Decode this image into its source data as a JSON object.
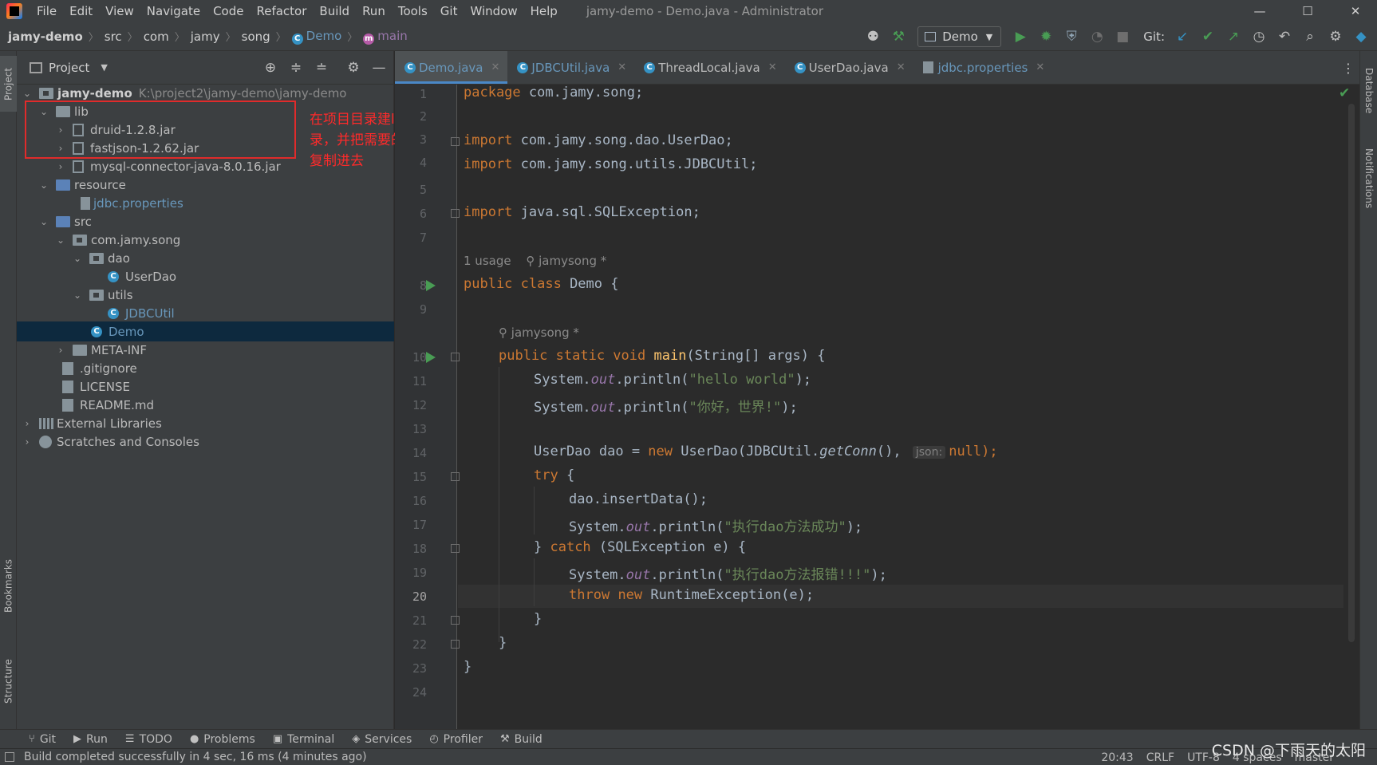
{
  "window": {
    "title": "jamy-demo - Demo.java - Administrator",
    "menu": [
      "File",
      "Edit",
      "View",
      "Navigate",
      "Code",
      "Refactor",
      "Build",
      "Run",
      "Tools",
      "Git",
      "Window",
      "Help"
    ],
    "minimize": "—",
    "maximize": "☐",
    "close": "✕"
  },
  "breadcrumb": {
    "project": "jamy-demo",
    "parts": [
      "src",
      "com",
      "jamy",
      "song"
    ],
    "class_name": "Demo",
    "method_name": "main"
  },
  "toolbar": {
    "run_config": "Demo",
    "git_label": "Git:"
  },
  "project_panel": {
    "title": "Project",
    "root_name": "jamy-demo",
    "root_path": "K:\\project2\\jamy-demo\\jamy-demo",
    "items": [
      {
        "label": "lib"
      },
      {
        "label": "druid-1.2.8.jar"
      },
      {
        "label": "fastjson-1.2.62.jar"
      },
      {
        "label": "mysql-connector-java-8.0.16.jar"
      },
      {
        "label": "resource"
      },
      {
        "label": "jdbc.properties"
      },
      {
        "label": "src"
      },
      {
        "label": "com.jamy.song"
      },
      {
        "label": "dao"
      },
      {
        "label": "UserDao"
      },
      {
        "label": "utils"
      },
      {
        "label": "JDBCUtil"
      },
      {
        "label": "Demo"
      },
      {
        "label": "META-INF"
      },
      {
        "label": ".gitignore"
      },
      {
        "label": "LICENSE"
      },
      {
        "label": "README.md"
      },
      {
        "label": "External Libraries"
      },
      {
        "label": "Scratches and Consoles"
      }
    ],
    "annotation": "在项目目录建lib目录，并把需要的jar包复制进去"
  },
  "editor": {
    "tabs": [
      {
        "label": "Demo.java",
        "active": true
      },
      {
        "label": "JDBCUtil.java",
        "active": false
      },
      {
        "label": "ThreadLocal.java",
        "active": false
      },
      {
        "label": "UserDao.java",
        "active": false
      },
      {
        "label": "jdbc.properties",
        "active": false
      }
    ],
    "current_line": 20,
    "hint_usage": "1 usage",
    "hint_author": "jamysong *",
    "inlay_json": "json:",
    "line_numbers": [
      "1",
      "2",
      "3",
      "4",
      "5",
      "6",
      "7",
      "8",
      "9",
      "10",
      "11",
      "12",
      "13",
      "14",
      "15",
      "16",
      "17",
      "18",
      "19",
      "20",
      "21",
      "22",
      "23",
      "24"
    ],
    "code": {
      "l1_kw": "package",
      "l1_rest": " com.jamy.song;",
      "l3_kw": "import",
      "l3_rest": " com.jamy.song.dao.UserDao;",
      "l4_kw": "import",
      "l4_rest": " com.jamy.song.utils.JDBCUtil;",
      "l6_kw": "import",
      "l6_rest": " java.sql.SQLException;",
      "l8_kw": "public class",
      "l8_rest": " Demo {",
      "l10_kw": "public static void",
      "l10_fn": "main",
      "l10_rest": "(String[] args) {",
      "sys": "System.",
      "out": "out",
      "println": ".println(",
      "l11_str": "\"hello world\"",
      "l12_str": "\"你好，世界!\"",
      "close_stmt": ");",
      "l14_a": "UserDao dao = ",
      "l14_new": "new",
      "l14_b": " UserDao(JDBCUtil.",
      "l14_getconn": "getConn",
      "l14_c": "(), ",
      "l14_null": "null);",
      "l15_kw": "try",
      "l15_rest": " {",
      "l16": "dao.insertData();",
      "l17_str": "\"执行dao方法成功\"",
      "l18_a": "} ",
      "l18_kw": "catch",
      "l18_rest": " (SQLException e) {",
      "l19_str": "\"执行dao方法报错!!!\"",
      "l20_kw1": "throw",
      "l20_kw2": "new",
      "l20_rest": " RuntimeException(e);",
      "brace": "}"
    }
  },
  "bottom_tools": [
    "Git",
    "Run",
    "TODO",
    "Problems",
    "Terminal",
    "Services",
    "Profiler",
    "Build"
  ],
  "status": {
    "message": "Build completed successfully in 4 sec, 16 ms (4 minutes ago)",
    "position": "20:43",
    "line_sep": "CRLF",
    "encoding": "UTF-8",
    "indent": "4 spaces",
    "branch": "master"
  },
  "side_tabs": {
    "project": "Project",
    "bookmarks": "Bookmarks",
    "structure": "Structure",
    "database": "Database",
    "notifications": "Notifications"
  },
  "watermark": "CSDN @下雨天的太阳"
}
